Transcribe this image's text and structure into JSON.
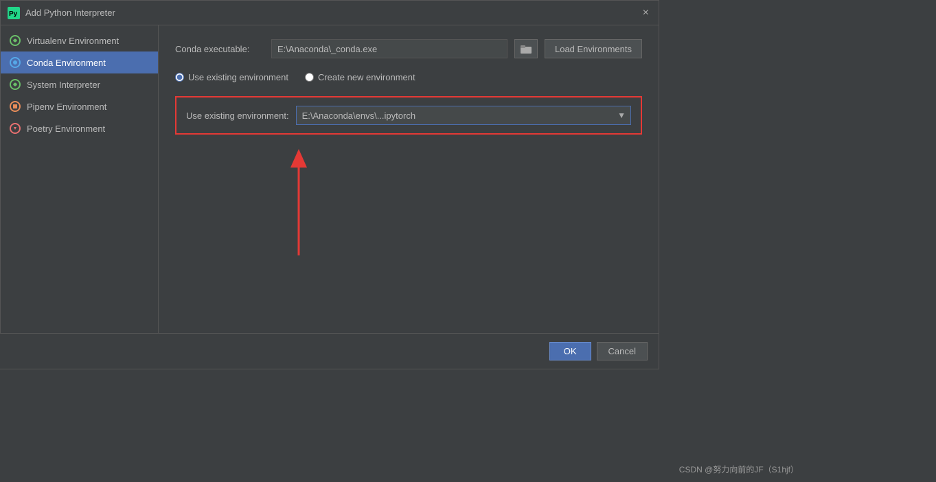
{
  "dialog": {
    "title": "Add Python Interpreter",
    "close_label": "×"
  },
  "sidebar": {
    "items": [
      {
        "id": "virtualenv",
        "label": "Virtualenv Environment",
        "icon_color": "#6abf69",
        "active": false
      },
      {
        "id": "conda",
        "label": "Conda Environment",
        "icon_color": "#56a8e8",
        "active": true
      },
      {
        "id": "system",
        "label": "System Interpreter",
        "icon_color": "#6abf69",
        "active": false
      },
      {
        "id": "pipenv",
        "label": "Pipenv Environment",
        "icon_color": "#e88d5a",
        "active": false
      },
      {
        "id": "poetry",
        "label": "Poetry Environment",
        "icon_color": "#e87070",
        "active": false
      }
    ]
  },
  "main": {
    "conda_executable_label": "Conda executable:",
    "conda_executable_value": "E:\\Anaconda\\_conda.exe",
    "browse_icon": "📁",
    "load_environments_label": "Load Environments",
    "radio_use_existing": "Use existing environment",
    "radio_create_new": "Create new environment",
    "use_existing_label": "Use existing environment:",
    "existing_env_value": "E:\\Anaconda\\envs\\...ipytorch"
  },
  "footer": {
    "ok_label": "OK",
    "cancel_label": "Cancel"
  },
  "watermark": {
    "text": "CSDN @努力向前的JF（S1hjf）"
  }
}
